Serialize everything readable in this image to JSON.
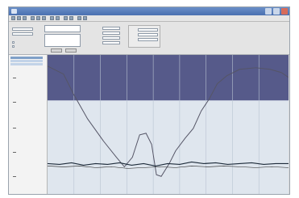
{
  "window": {
    "title": "",
    "accent": "#4a70b0"
  },
  "toolbar": {
    "icons": [
      "open-icon",
      "save-icon",
      "print-icon",
      "cut-icon",
      "copy-icon",
      "paste-icon",
      "zoom-in-icon",
      "zoom-out-icon",
      "play-icon",
      "stop-icon",
      "settings-icon",
      "help-icon"
    ]
  },
  "form": {
    "left_label": "",
    "input_left": "",
    "btn_ok": "",
    "btn_cancel": ""
  },
  "plot": {
    "band_color": "#565a8a",
    "background": "#dfe6ee",
    "series_colors": [
      "#555566",
      "#1d2b3a",
      "#222222"
    ],
    "annotations": [
      "",
      "",
      "",
      "",
      ""
    ]
  }
}
